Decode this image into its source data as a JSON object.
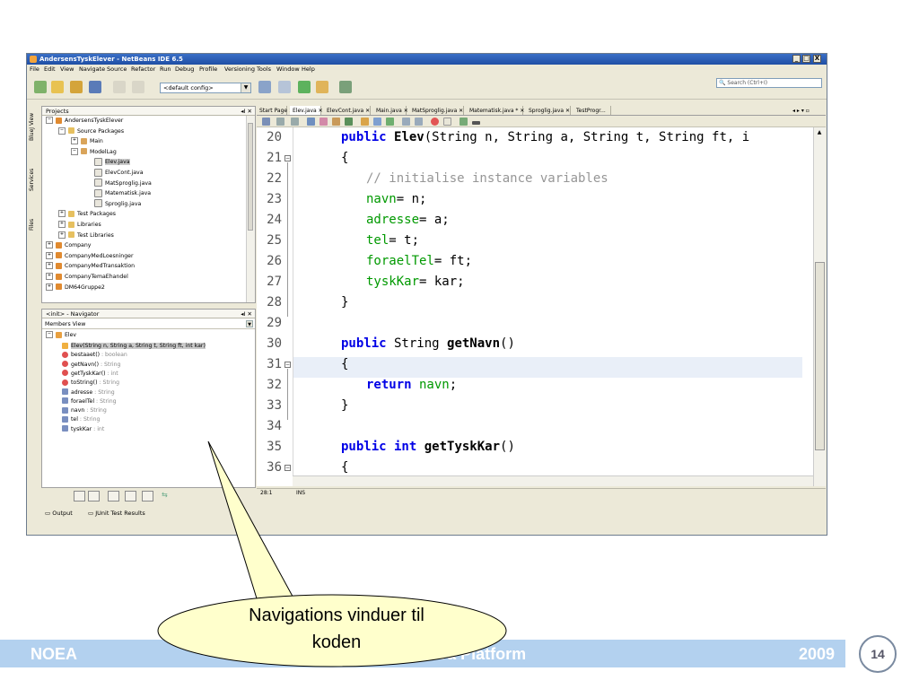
{
  "window": {
    "title": "AndersensTyskElever - NetBeans IDE 6.5",
    "min": "_",
    "max": "□",
    "close": "X"
  },
  "menu": [
    "File",
    "Edit",
    "View",
    "Navigate",
    "Source",
    "Refactor",
    "Run",
    "Debug",
    "Profile",
    "Versioning",
    "Tools",
    "Window",
    "Help"
  ],
  "toolbar": {
    "config": "<default config>",
    "search_placeholder": "Search (Ctrl+I)"
  },
  "side_tabs": [
    "BlueJ View",
    "Services",
    "Files"
  ],
  "projects": {
    "title": "Projects",
    "controls": "◂I ✕",
    "tree": [
      {
        "label": "AndersensTyskElever",
        "depth": 0,
        "exp": "−",
        "icon": "project-icon"
      },
      {
        "label": "Source Packages",
        "depth": 1,
        "exp": "−",
        "icon": "folder-icon"
      },
      {
        "label": "Main",
        "depth": 2,
        "exp": "+",
        "icon": "package-icon"
      },
      {
        "label": "ModelLag",
        "depth": 2,
        "exp": "−",
        "icon": "package-icon"
      },
      {
        "label": "Elev.java",
        "depth": 3,
        "exp": "",
        "icon": "java-file-icon",
        "selected": true
      },
      {
        "label": "ElevCont.java",
        "depth": 3,
        "exp": "",
        "icon": "java-file-icon"
      },
      {
        "label": "MatSproglig.java",
        "depth": 3,
        "exp": "",
        "icon": "java-file-icon"
      },
      {
        "label": "Matematisk.java",
        "depth": 3,
        "exp": "",
        "icon": "java-file-icon"
      },
      {
        "label": "Sproglig.java",
        "depth": 3,
        "exp": "",
        "icon": "java-file-icon"
      },
      {
        "label": "Test Packages",
        "depth": 1,
        "exp": "+",
        "icon": "folder-icon"
      },
      {
        "label": "Libraries",
        "depth": 1,
        "exp": "+",
        "icon": "folder-icon"
      },
      {
        "label": "Test Libraries",
        "depth": 1,
        "exp": "+",
        "icon": "folder-icon"
      },
      {
        "label": "Company",
        "depth": 0,
        "exp": "+",
        "icon": "project-icon"
      },
      {
        "label": "CompanyMedLoesninger",
        "depth": 0,
        "exp": "+",
        "icon": "project-icon"
      },
      {
        "label": "CompanyMedTransaktion",
        "depth": 0,
        "exp": "+",
        "icon": "project-icon"
      },
      {
        "label": "CompanyTemaEhandel",
        "depth": 0,
        "exp": "+",
        "icon": "project-icon"
      },
      {
        "label": "DM64Gruppe2",
        "depth": 0,
        "exp": "+",
        "icon": "project-icon"
      }
    ]
  },
  "navigator": {
    "title": "<init> - Navigator",
    "controls": "◂I ✕",
    "view": "Members View",
    "class_name": "Elev",
    "members": [
      {
        "name": "Elev(String n, String a, String t, String ft, int kar)",
        "type": "",
        "kind": "constructor",
        "selected": true
      },
      {
        "name": "bestaaet()",
        "type": " : boolean",
        "kind": "method"
      },
      {
        "name": "getNavn()",
        "type": " : String",
        "kind": "method"
      },
      {
        "name": "getTyskKar()",
        "type": " : int",
        "kind": "method"
      },
      {
        "name": "toString()",
        "type": " : String",
        "kind": "method"
      },
      {
        "name": "adresse",
        "type": " : String",
        "kind": "field"
      },
      {
        "name": "foraelTel",
        "type": " : String",
        "kind": "field"
      },
      {
        "name": "navn",
        "type": " : String",
        "kind": "field"
      },
      {
        "name": "tel",
        "type": " : String",
        "kind": "field"
      },
      {
        "name": "tyskKar",
        "type": " : int",
        "kind": "field"
      }
    ]
  },
  "bottom_tabs": [
    "Output",
    "JUnit Test Results"
  ],
  "editor_tabs": [
    {
      "label": "Start Page ✕",
      "active": false
    },
    {
      "label": "Elev.java ✕",
      "active": true
    },
    {
      "label": "ElevCont.java ✕",
      "active": false
    },
    {
      "label": "Main.java ✕",
      "active": false
    },
    {
      "label": "MatSproglig.java ✕",
      "active": false
    },
    {
      "label": "Matematisk.java * ✕",
      "active": false
    },
    {
      "label": "Sproglig.java ✕",
      "active": false
    },
    {
      "label": "TestProgr...",
      "active": false
    }
  ],
  "code_lines": [
    {
      "n": "20",
      "fold": ""
    },
    {
      "n": "21",
      "fold": "−"
    },
    {
      "n": "22",
      "fold": ""
    },
    {
      "n": "23",
      "fold": ""
    },
    {
      "n": "24",
      "fold": ""
    },
    {
      "n": "25",
      "fold": ""
    },
    {
      "n": "26",
      "fold": ""
    },
    {
      "n": "27",
      "fold": ""
    },
    {
      "n": "28",
      "fold": ""
    },
    {
      "n": "29",
      "fold": ""
    },
    {
      "n": "30",
      "fold": ""
    },
    {
      "n": "31",
      "fold": "−"
    },
    {
      "n": "32",
      "fold": ""
    },
    {
      "n": "33",
      "fold": ""
    },
    {
      "n": "34",
      "fold": ""
    },
    {
      "n": "35",
      "fold": ""
    },
    {
      "n": "36",
      "fold": "−"
    }
  ],
  "code": {
    "l20_kw": "public",
    "l20_name": "Elev",
    "l20_rest": "(String n, String a, String t, String ft, i",
    "l21": "{",
    "l22": "// initialise instance variables",
    "l23_f": "navn",
    "l23_r": "= n;",
    "l24_f": "adresse",
    "l24_r": "= a;",
    "l25_f": "tel",
    "l25_r": "= t;",
    "l26_f": "foraelTel",
    "l26_r": "= ft;",
    "l27_f": "tyskKar",
    "l27_r": "= kar;",
    "l28": "}",
    "l30_kw": "public",
    "l30_type": " String ",
    "l30_name": "getNavn",
    "l30_rest": "()",
    "l31": "{",
    "l32_kw": "return",
    "l32_f": " navn",
    "l32_r": ";",
    "l33": "}",
    "l35_kw": "public int",
    "l35_name": " getTyskKar",
    "l35_rest": "()",
    "l36": "{"
  },
  "status": {
    "pos": "28:1",
    "mode": "INS"
  },
  "callout": {
    "line1": "Navigations vinduer til",
    "line2": "koden"
  },
  "footer": {
    "left": "NOEA",
    "middle": "Java-Kursus – Java Platform",
    "year": "2009",
    "page": "14"
  }
}
